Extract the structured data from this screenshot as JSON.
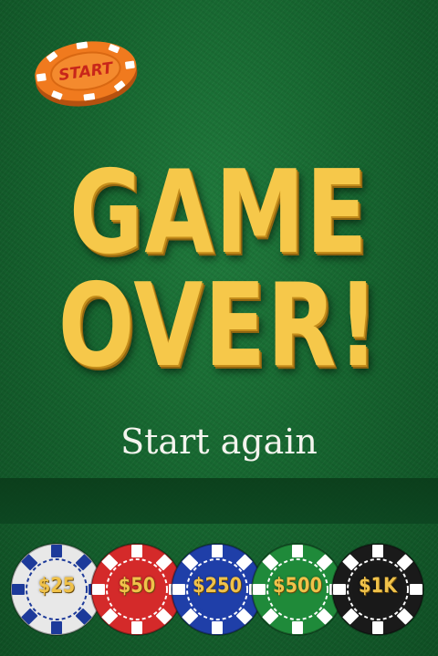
{
  "screen": {
    "title_line1": "GAME",
    "title_line2": "OVER!",
    "restart_label": "Start again"
  },
  "start_chip": {
    "label": "START",
    "color": "#f07a1e"
  },
  "chips": [
    {
      "label": "$25",
      "color": "#e8e8e8",
      "accent": "#1d3a9a"
    },
    {
      "label": "$50",
      "color": "#d42a2a",
      "accent": "#ffffff"
    },
    {
      "label": "$250",
      "color": "#1f3fa8",
      "accent": "#ffffff"
    },
    {
      "label": "$500",
      "color": "#1f8a3a",
      "accent": "#ffffff"
    },
    {
      "label": "$1K",
      "color": "#1a1a1a",
      "accent": "#ffffff"
    }
  ],
  "colors": {
    "felt": "#16652f",
    "title_gold": "#f6c84a"
  }
}
